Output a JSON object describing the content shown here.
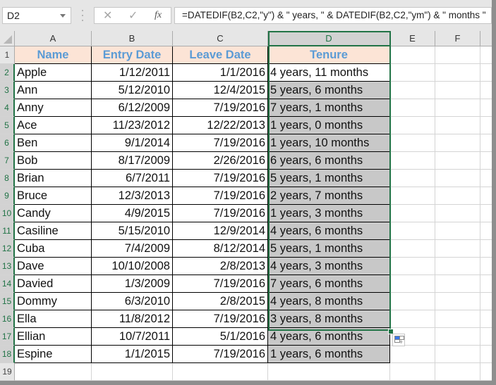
{
  "formula_bar": {
    "name_box": "D2",
    "cancel_icon": "✕",
    "enter_icon": "✓",
    "fx_label": "fx",
    "formula": "=DATEDIF(B2,C2,\"y\") & \" years, \" & DATEDIF(B2,C2,\"ym\") & \" months \""
  },
  "columns": [
    "A",
    "B",
    "C",
    "D",
    "E",
    "F"
  ],
  "selected_column": "D",
  "row_numbers": [
    "1",
    "2",
    "3",
    "4",
    "5",
    "6",
    "7",
    "8",
    "9",
    "10",
    "11",
    "12",
    "13",
    "14",
    "15",
    "16",
    "17",
    "18",
    "19"
  ],
  "table": {
    "headers": [
      "Name",
      "Entry Date",
      "Leave Date",
      "Tenure"
    ],
    "rows": [
      [
        "Apple",
        "1/12/2011",
        "1/1/2016",
        "4 years, 11 months"
      ],
      [
        "Ann",
        "5/12/2010",
        "12/4/2015",
        "5 years, 6 months"
      ],
      [
        "Anny",
        "6/12/2009",
        "7/19/2016",
        "7 years, 1 months"
      ],
      [
        "Ace",
        "11/23/2012",
        "12/22/2013",
        "1 years, 0 months"
      ],
      [
        "Ben",
        "9/1/2014",
        "7/19/2016",
        "1 years, 10 months"
      ],
      [
        "Bob",
        "8/17/2009",
        "2/26/2016",
        "6 years, 6 months"
      ],
      [
        "Brian",
        "6/7/2011",
        "7/19/2016",
        "5 years, 1 months"
      ],
      [
        "Bruce",
        "12/3/2013",
        "7/19/2016",
        "2 years, 7 months"
      ],
      [
        "Candy",
        "4/9/2015",
        "7/19/2016",
        "1 years, 3 months"
      ],
      [
        "Casiline",
        "5/15/2010",
        "12/9/2014",
        "4 years, 6 months"
      ],
      [
        "Cuba",
        "7/4/2009",
        "8/12/2014",
        "5 years, 1 months"
      ],
      [
        "Dave",
        "10/10/2008",
        "2/8/2013",
        "4 years, 3 months"
      ],
      [
        "Davied",
        "1/3/2009",
        "7/19/2016",
        "7 years, 6 months"
      ],
      [
        "Dommy",
        "6/3/2010",
        "2/8/2015",
        "4 years, 8 months"
      ],
      [
        "Ella",
        "11/8/2012",
        "7/19/2016",
        "3 years, 8 months"
      ],
      [
        "Ellian",
        "10/7/2011",
        "5/1/2016",
        "4 years, 6 months"
      ],
      [
        "Espine",
        "1/1/2015",
        "7/19/2016",
        "1 years, 6 months"
      ]
    ]
  },
  "colors": {
    "header_fill": "#fce4d6",
    "header_text": "#5b9bd5",
    "selection_accent": "#217346",
    "selected_range_fill": "#c8c8c8"
  }
}
